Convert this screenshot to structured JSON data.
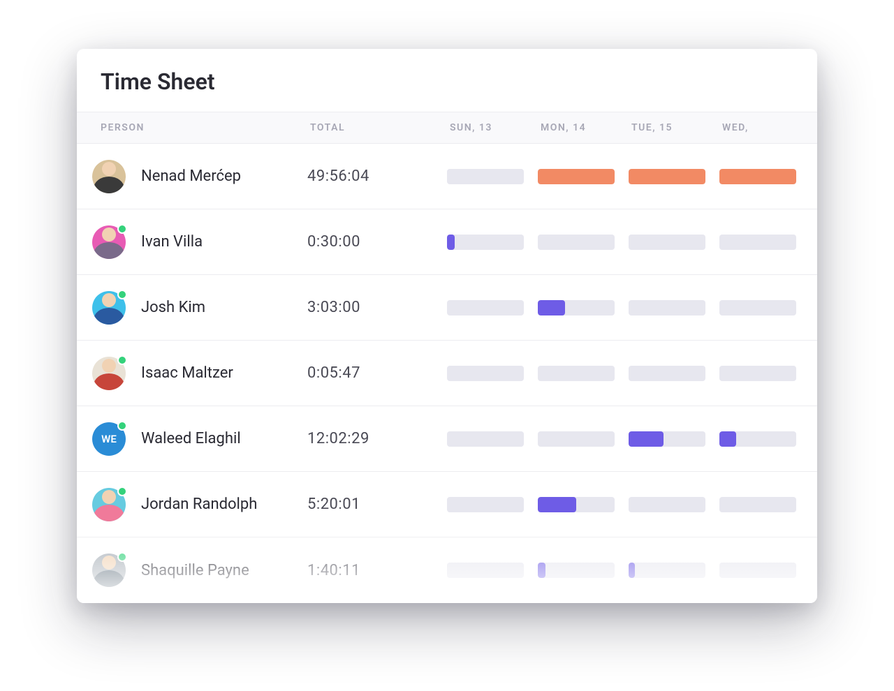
{
  "title": "Time Sheet",
  "columns": {
    "person": "PERSON",
    "total": "TOTAL",
    "days": [
      "SUN, 13",
      "MON, 14",
      "TUE, 15",
      "WED,"
    ]
  },
  "colors": {
    "orange": "#f28a64",
    "purple": "#6e5ce6",
    "empty": "#e7e7ef"
  },
  "rows": [
    {
      "name": "Nenad Merćep",
      "total": "49:56:04",
      "avatar": {
        "type": "photo",
        "bg": "#d9c29a",
        "body": "#3a3a3a",
        "initials": ""
      },
      "online": false,
      "days": [
        {
          "fill": 0,
          "color": "empty"
        },
        {
          "fill": 100,
          "color": "orange"
        },
        {
          "fill": 100,
          "color": "orange"
        },
        {
          "fill": 100,
          "color": "orange"
        }
      ]
    },
    {
      "name": "Ivan Villa",
      "total": "0:30:00",
      "avatar": {
        "type": "photo",
        "bg": "#e85bb4",
        "body": "#7a6a8a",
        "initials": ""
      },
      "online": true,
      "days": [
        {
          "fill": 10,
          "color": "purple"
        },
        {
          "fill": 0,
          "color": "empty"
        },
        {
          "fill": 0,
          "color": "empty"
        },
        {
          "fill": 0,
          "color": "empty"
        }
      ]
    },
    {
      "name": "Josh Kim",
      "total": "3:03:00",
      "avatar": {
        "type": "photo",
        "bg": "#3ec0ea",
        "body": "#2a5aa0",
        "initials": ""
      },
      "online": true,
      "days": [
        {
          "fill": 0,
          "color": "empty"
        },
        {
          "fill": 35,
          "color": "purple"
        },
        {
          "fill": 0,
          "color": "empty"
        },
        {
          "fill": 0,
          "color": "empty"
        }
      ]
    },
    {
      "name": "Isaac Maltzer",
      "total": "0:05:47",
      "avatar": {
        "type": "photo",
        "bg": "#e9e2d6",
        "body": "#c7453a",
        "initials": ""
      },
      "online": true,
      "days": [
        {
          "fill": 0,
          "color": "empty"
        },
        {
          "fill": 0,
          "color": "empty"
        },
        {
          "fill": 0,
          "color": "empty"
        },
        {
          "fill": 0,
          "color": "empty"
        }
      ]
    },
    {
      "name": "Waleed Elaghil",
      "total": "12:02:29",
      "avatar": {
        "type": "initials",
        "bg": "#2a8cd6",
        "body": "",
        "initials": "WE"
      },
      "online": true,
      "days": [
        {
          "fill": 0,
          "color": "empty"
        },
        {
          "fill": 0,
          "color": "empty"
        },
        {
          "fill": 45,
          "color": "purple"
        },
        {
          "fill": 22,
          "color": "purple"
        }
      ]
    },
    {
      "name": "Jordan Randolph",
      "total": "5:20:01",
      "avatar": {
        "type": "photo",
        "bg": "#66cbe0",
        "body": "#f07a9a",
        "initials": ""
      },
      "online": true,
      "days": [
        {
          "fill": 0,
          "color": "empty"
        },
        {
          "fill": 50,
          "color": "purple"
        },
        {
          "fill": 0,
          "color": "empty"
        },
        {
          "fill": 0,
          "color": "empty"
        }
      ]
    },
    {
      "name": "Shaquille Payne",
      "total": "1:40:11",
      "avatar": {
        "type": "photo",
        "bg": "#a8b0b8",
        "body": "#5a6a78",
        "initials": ""
      },
      "online": true,
      "days": [
        {
          "fill": 0,
          "color": "empty"
        },
        {
          "fill": 10,
          "color": "purple"
        },
        {
          "fill": 8,
          "color": "purple"
        },
        {
          "fill": 0,
          "color": "empty"
        }
      ]
    }
  ]
}
